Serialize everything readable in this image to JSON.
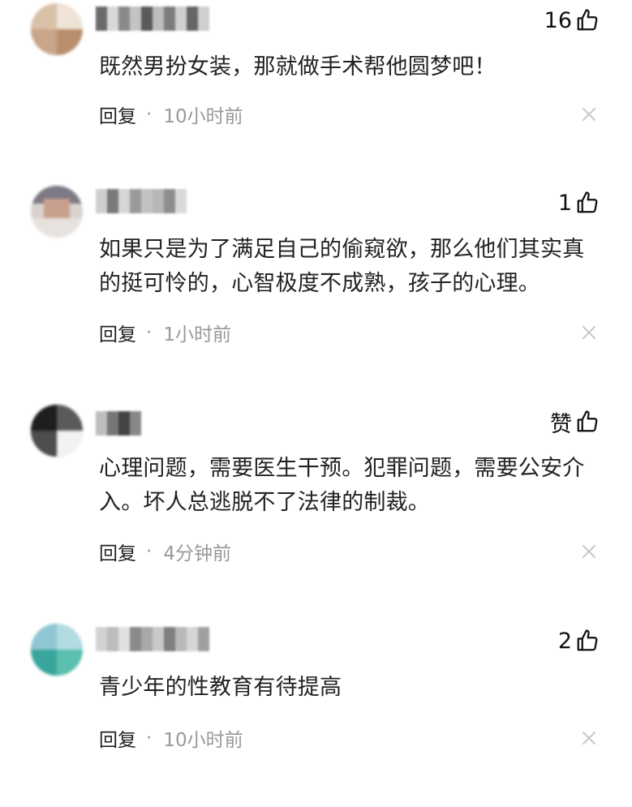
{
  "comments": [
    {
      "likes": "16",
      "text": "既然男扮女装，那就做手术帮他圆梦吧！",
      "reply_label": "回复",
      "separator": "·",
      "time": "10小时前"
    },
    {
      "likes": "1",
      "text": "如果只是为了满足自己的偷窥欲，那么他们其实真的挺可怜的，心智极度不成熟，孩子的心理。",
      "reply_label": "回复",
      "separator": "·",
      "time": "1小时前"
    },
    {
      "likes": "赞",
      "text": "心理问题，需要医生干预。犯罪问题，需要公安介入。坏人总逃脱不了法律的制裁。",
      "reply_label": "回复",
      "separator": "·",
      "time": "4分钟前"
    },
    {
      "likes": "2",
      "text": "青少年的性教育有待提高",
      "reply_label": "回复",
      "separator": "·",
      "time": "10小时前"
    }
  ],
  "icons": {
    "like": "thumbs-up-icon",
    "close": "close-icon",
    "avatar": "blurred-avatar",
    "username": "blurred-username"
  },
  "colors": {
    "text": "#222222",
    "muted": "#999999",
    "close": "#c8c8c8"
  }
}
